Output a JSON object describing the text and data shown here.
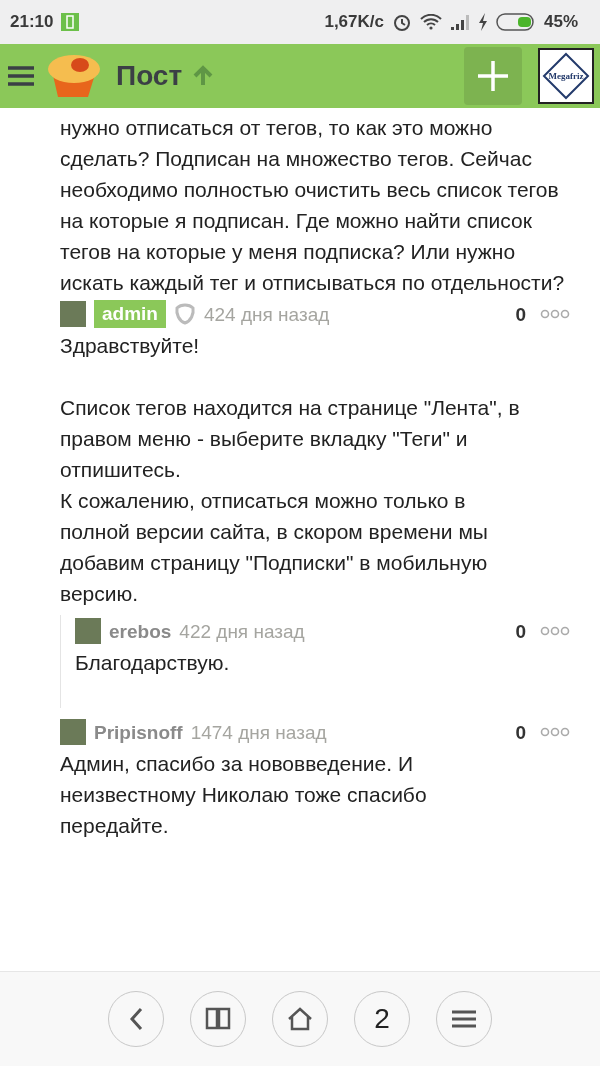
{
  "status_bar": {
    "time": "21:10",
    "speed": "1,67K/c",
    "battery": "45%"
  },
  "header": {
    "title": "Пост",
    "avatar_label": "Megafriz"
  },
  "post_text": "нужно отписаться от тегов, то как это можно сделать? Подписан на множество тегов. Сейчас необходимо полностью очистить весь список тегов на которые я подписан. Где можно найти список тегов на которые у меня подписка? Или нужно искать каждый тег и отписываться по отдельности?",
  "comments": [
    {
      "author": "admin",
      "is_admin": true,
      "time": "424 дня назад",
      "rating": "0",
      "paragraphs": [
        "Здравствуйте!",
        "Список тегов находится на странице \"Лента\", в правом меню - выберите вкладку \"Теги\" и отпишитесь.\nК сожалению, отписаться можно только в полной версии сайта, в скором времени мы добавим страницу \"Подписки\" в мобильную версию."
      ],
      "children": [
        {
          "author": "erebos",
          "is_admin": false,
          "time": "422 дня назад",
          "rating": "0",
          "paragraphs": [
            "Благодарствую."
          ]
        }
      ]
    },
    {
      "author": "Pripisnoff",
      "is_admin": false,
      "time": "1474 дня назад",
      "rating": "0",
      "paragraphs": [
        "Админ, спасибо за нововведение. И неизвестному Николаю тоже спасибо передайте."
      ]
    }
  ],
  "nav_buttons": [
    {
      "kind": "back"
    },
    {
      "kind": "book"
    },
    {
      "kind": "home"
    },
    {
      "kind": "tabs",
      "label": "2"
    },
    {
      "kind": "menu"
    }
  ]
}
